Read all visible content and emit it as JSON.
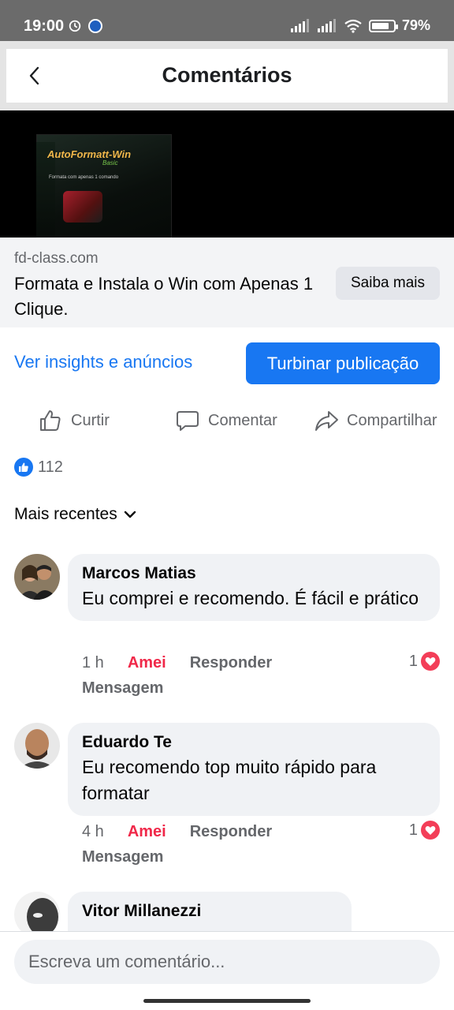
{
  "status_bar": {
    "time": "19:00",
    "battery": "79%",
    "battery_level": 0.79
  },
  "header": {
    "title": "Comentários",
    "back_icon": "chevron-left-icon"
  },
  "ad": {
    "product_name": "AutoFormatt-Win",
    "product_edition": "Basic",
    "product_tagline": "Formata com apenas 1 comando",
    "domain": "fd-class.com",
    "headline": "Formata e Instala o Win com Apenas 1 Clique.",
    "cta_label": "Saiba mais"
  },
  "insights": {
    "link_label": "Ver insights e anúncios",
    "boost_label": "Turbinar publicação"
  },
  "actions": {
    "like_label": "Curtir",
    "comment_label": "Comentar",
    "share_label": "Compartilhar"
  },
  "reactions": {
    "count": "112"
  },
  "sort": {
    "label": "Mais recentes"
  },
  "comments": [
    {
      "author": "Marcos Matias",
      "text": "Eu comprei e recomendo. É fácil e prático",
      "time": "1 h",
      "reaction_label": "Amei",
      "reply_label": "Responder",
      "message_label": "Mensagem",
      "love_count": "1"
    },
    {
      "author": "Eduardo Te",
      "text": "Eu recomendo top muito rápido para formatar",
      "time": "4 h",
      "reaction_label": "Amei",
      "reply_label": "Responder",
      "message_label": "Mensagem",
      "love_count": "1"
    },
    {
      "author": "Vitor Millanezzi",
      "text": ""
    }
  ],
  "composer": {
    "placeholder": "Escreva um comentário..."
  },
  "colors": {
    "brand_blue": "#1877f2",
    "love_red": "#f02849",
    "bubble_gray": "#f0f2f5",
    "secondary_text": "#65676b"
  }
}
